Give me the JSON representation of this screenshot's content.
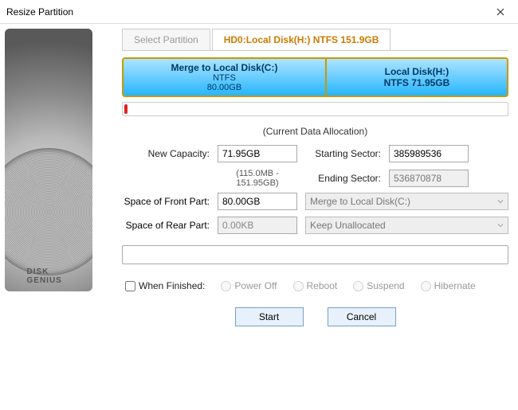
{
  "window": {
    "title": "Resize Partition"
  },
  "tabs": {
    "select_label": "Select Partition",
    "selected_label": "HD0:Local Disk(H:) NTFS 151.9GB"
  },
  "partitions": [
    {
      "title": "Merge to Local Disk(C:)",
      "fs": "NTFS",
      "size": "80.00GB",
      "width_pct": 53
    },
    {
      "title": "Local Disk(H:)",
      "fs": "NTFS 71.95GB",
      "size": "",
      "width_pct": 47
    }
  ],
  "alloc_title": "(Current Data Allocation)",
  "fields": {
    "new_capacity_label": "New Capacity:",
    "new_capacity_value": "71.95GB",
    "range_hint": "(115.0MB - 151.95GB)",
    "starting_sector_label": "Starting Sector:",
    "starting_sector_value": "385989536",
    "ending_sector_label": "Ending Sector:",
    "ending_sector_value": "536870878",
    "front_label": "Space of Front Part:",
    "front_value": "80.00GB",
    "front_action": "Merge to Local Disk(C:)",
    "rear_label": "Space of Rear Part:",
    "rear_value": "0.00KB",
    "rear_action": "Keep Unallocated"
  },
  "finish": {
    "checkbox_label": "When Finished:",
    "options": [
      "Power Off",
      "Reboot",
      "Suspend",
      "Hibernate"
    ]
  },
  "buttons": {
    "start": "Start",
    "cancel": "Cancel"
  }
}
